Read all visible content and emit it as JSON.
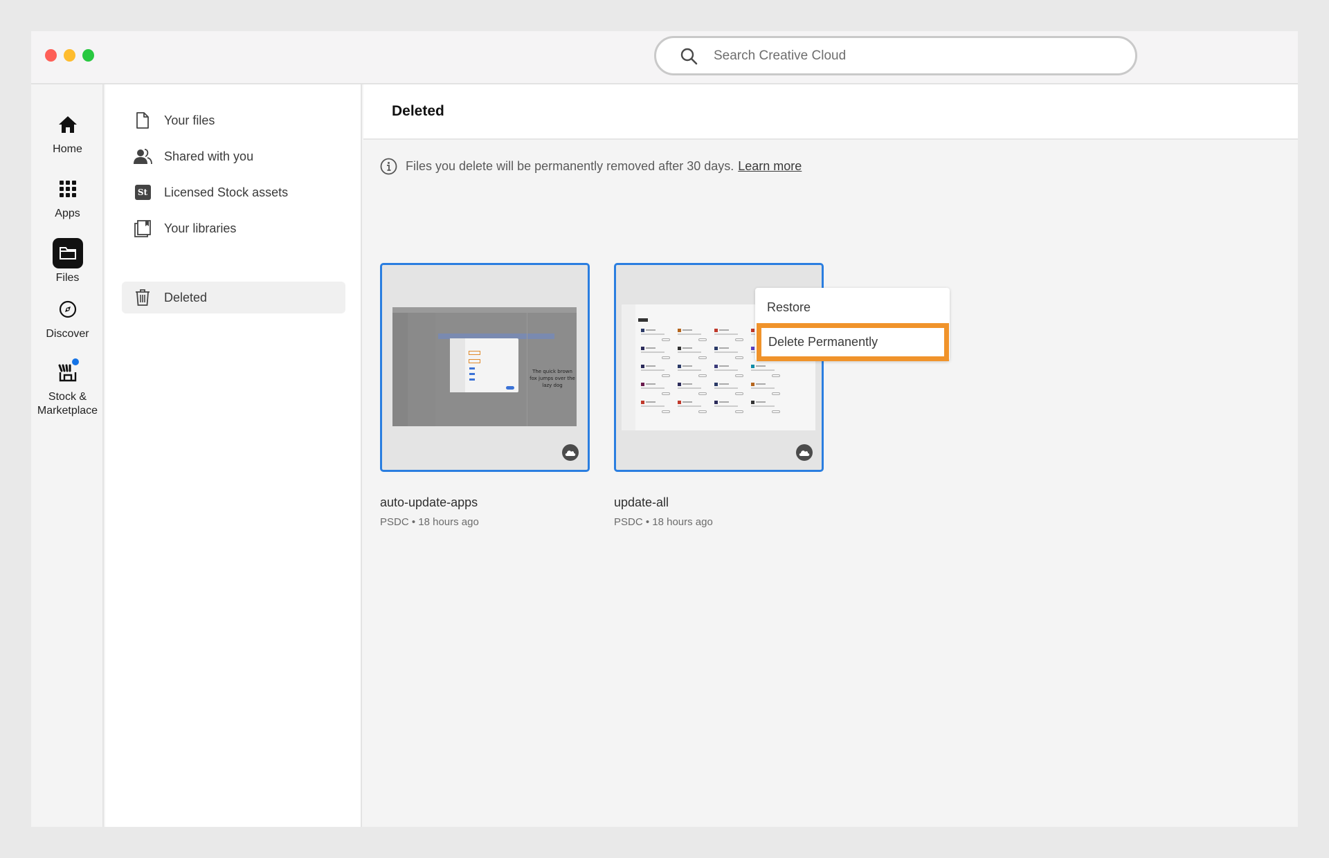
{
  "window": {
    "traffic_lights": [
      "close",
      "minimize",
      "maximize"
    ]
  },
  "search": {
    "placeholder": "Search Creative Cloud",
    "value": "",
    "icon": "search-icon"
  },
  "rail": {
    "items": [
      {
        "label": "Home",
        "icon": "home-icon",
        "active": false
      },
      {
        "label": "Apps",
        "icon": "apps-grid-icon",
        "active": false
      },
      {
        "label": "Files",
        "icon": "folder-icon",
        "active": true
      },
      {
        "label": "Discover",
        "icon": "compass-icon",
        "active": false
      },
      {
        "label": "Stock &\nMarketplace",
        "label_line1": "Stock &",
        "label_line2": "Marketplace",
        "icon": "storefront-icon",
        "has_notification_dot": true
      }
    ]
  },
  "nav": {
    "items": [
      {
        "label": "Your files",
        "icon": "document-icon",
        "active": false
      },
      {
        "label": "Shared with you",
        "icon": "users-icon",
        "active": false
      },
      {
        "label": "Licensed Stock assets",
        "icon": "stock-st-icon",
        "icon_text": "St",
        "active": false
      },
      {
        "label": "Your libraries",
        "icon": "libraries-icon",
        "active": false
      },
      {
        "label": "Deleted",
        "icon": "trash-icon",
        "active": true
      }
    ]
  },
  "main": {
    "title": "Deleted",
    "notice": {
      "text": "Files you delete will be permanently removed after 30 days.",
      "link": "Learn more"
    },
    "files": [
      {
        "name": "auto-update-apps",
        "type": "PSDC",
        "modified": "18 hours ago",
        "meta": "PSDC • 18 hours ago",
        "thumb_text": "The quick brown fox jumps over the lazy dog",
        "selected": true
      },
      {
        "name": "update-all",
        "type": "PSDC",
        "modified": "18 hours ago",
        "meta": "PSDC • 18 hours ago",
        "selected": true
      }
    ],
    "context_menu": {
      "items": [
        {
          "label": "Restore",
          "highlighted": false
        },
        {
          "label": "Delete Permanently",
          "highlighted": true
        }
      ]
    }
  },
  "colors": {
    "selection_blue": "#2a7ee0",
    "highlight_orange": "#f0932b",
    "notification_blue": "#1473e6"
  }
}
